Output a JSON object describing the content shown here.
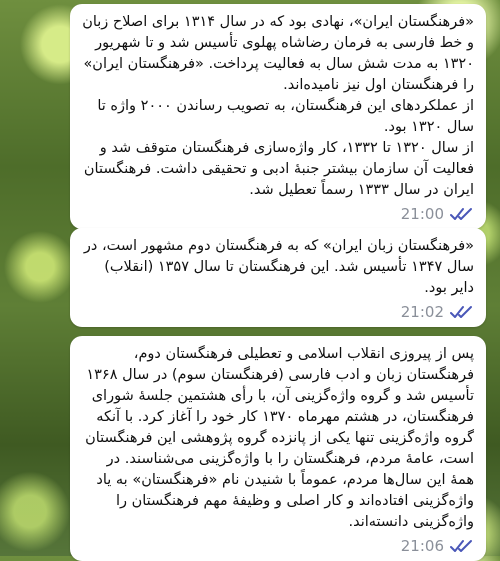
{
  "messages": [
    {
      "text": "«فرهنگستان ایران»، نهادی بود که در سال ۱۳۱۴ برای اصلاح زبان و خط فارسی به فرمان رضاشاه پهلوی تأسیس شد و تا شهریور ۱۳۲۰ به مدت شش سال به فعالیت پرداخت. «فرهنگستان ایران» را فرهنگستان اول نیز نامیده‌اند.\nاز عملکردهای این فرهنگستان، به تصویب رساندن ۲۰۰۰ واژه تا سال ۱۳۲۰ بود.\nاز سال ۱۳۲۰ تا ۱۳۳۲، کار واژه‌سازی فرهنگستان متوقف شد و فعالیت آن سازمان بیشتر جنبهٔ ادبی و تحقیقی داشت. فرهنگستان ایران در سال ۱۳۳۳ رسماً تعطیل شد.",
      "time": "21:00",
      "status_icon": "double-check-icon"
    },
    {
      "text": "«فرهنگستان زبان ایران» که به فرهنگستان دوم مشهور است، در سال ۱۳۴۷ تأسیس شد. این فرهنگستان تا سال ۱۳۵۷ (انقلاب) دایر بود.",
      "time": "21:02",
      "status_icon": "double-check-icon"
    },
    {
      "text": "پس از پیروزی انقلاب اسلامی و تعطیلی فرهنگستان دوم، فرهنگستان زبان و ادب فارسی (فرهنگستان سوم) در سال ۱۳۶۸ تأسیس شد و گروه واژه‌گزینی آن، با رأی هشتمین جلسهٔ شورای فرهنگستان، در هشتم مهرماه ۱۳۷۰ کار خود را آغاز کرد. با آنکه گروه واژه‌گزینی تنها یکی از پانزده گروه پژوهشی این فرهنگستان است، عامهٔ مردم، فرهنگستان را با واژه‌گزینی می‌شناسند. در همهٔ این سال‌ها مردم، عموماً با شنیدن نام «فرهنگستان» به یاد واژه‌گزینی افتاده‌اند و کار اصلی و وظیفهٔ مهم فرهنگستان را واژه‌گزینی دانسته‌اند.",
      "time": "21:06",
      "status_icon": "double-check-icon"
    }
  ],
  "colors": {
    "bubble": "#ffffff",
    "time": "#8a8f99",
    "ticks": "#4a57b8"
  }
}
